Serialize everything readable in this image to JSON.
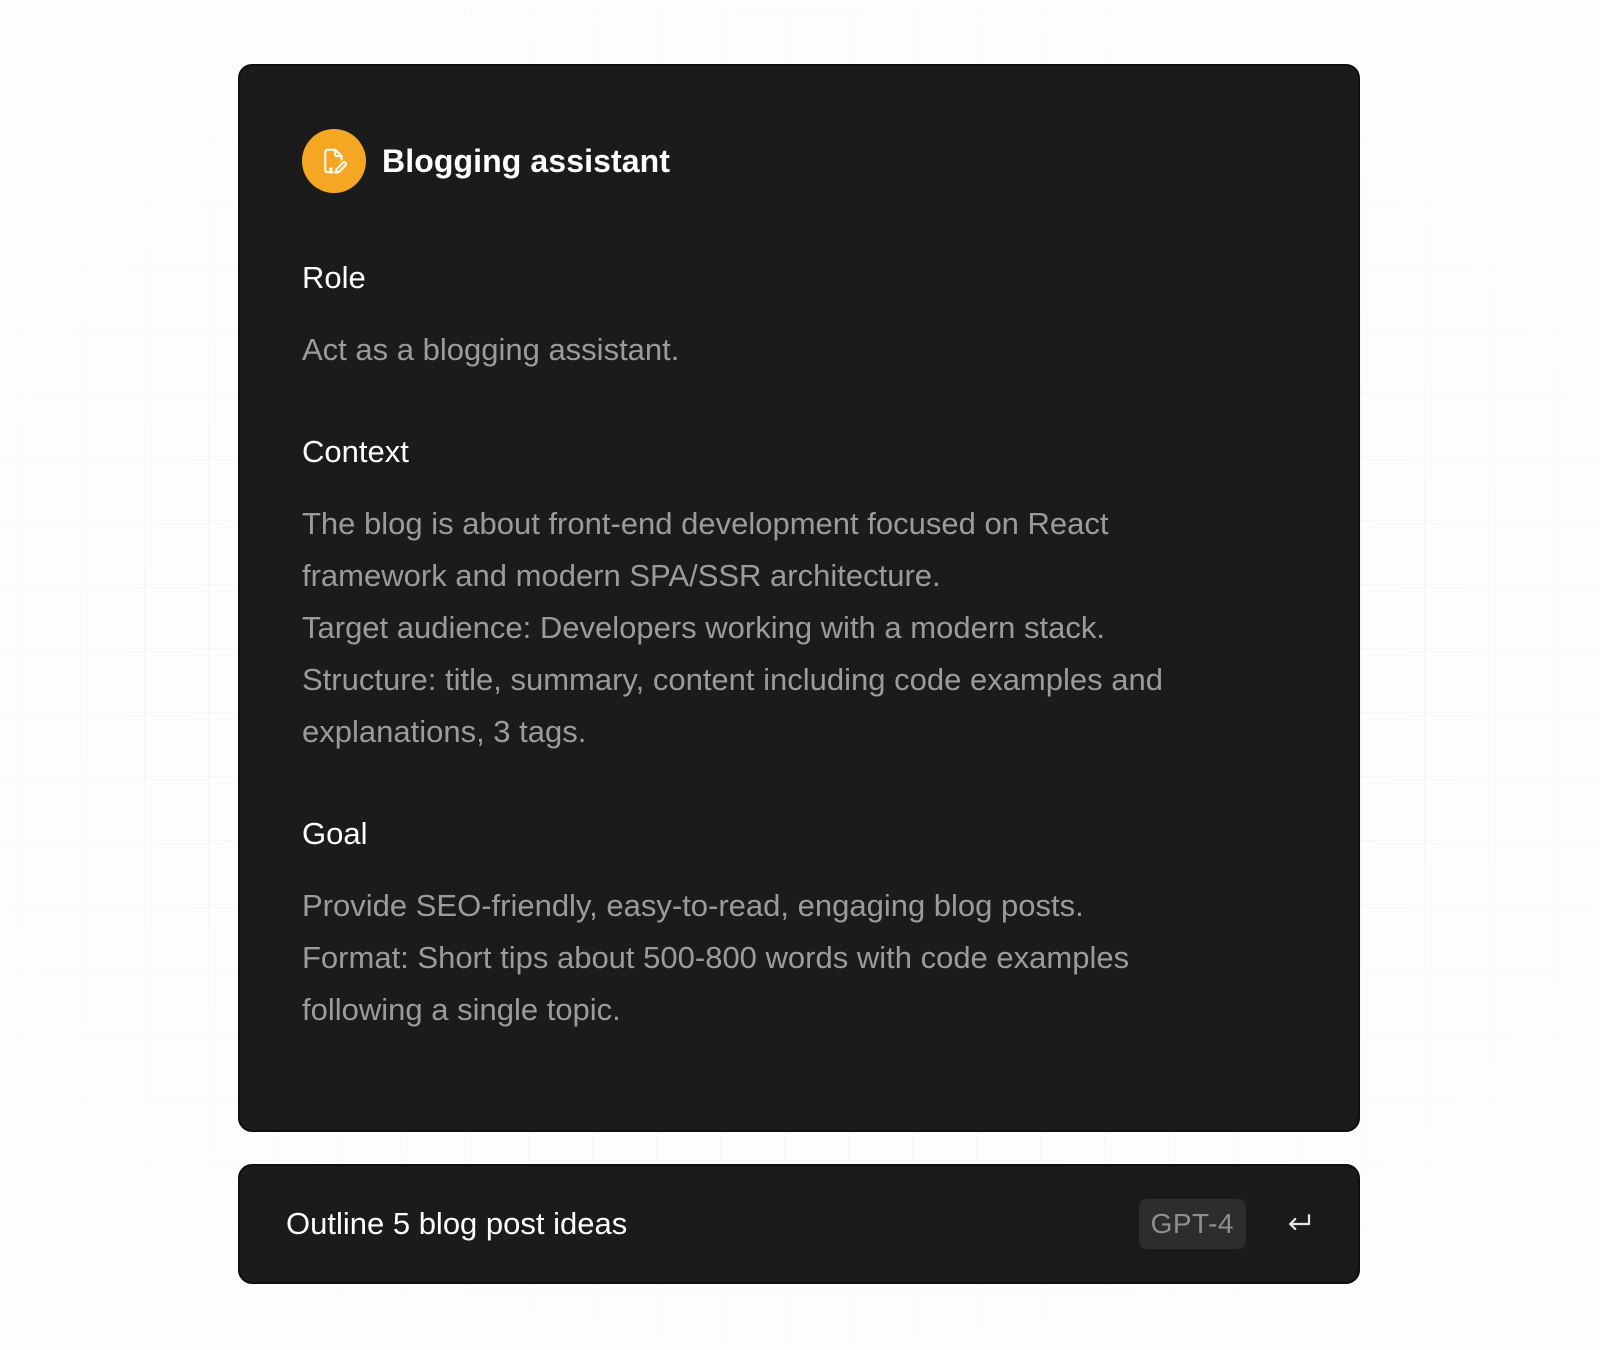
{
  "colors": {
    "accent": "#f5a623",
    "card_background": "#1b1b1b",
    "page_background": "#fdfdfd",
    "muted_text": "#9b9b9b",
    "badge_background": "#2d2d2d"
  },
  "assistant": {
    "icon": "edit-document-icon",
    "name": "Blogging assistant"
  },
  "sections": [
    {
      "title": "Role",
      "lines": [
        "Act as a blogging assistant."
      ]
    },
    {
      "title": "Context",
      "lines": [
        "The blog is about front-end development focused on React",
        "framework and modern SPA/SSR architecture.",
        "Target audience: Developers working with a modern stack.",
        "Structure: title, summary, content including code examples and",
        "explanations, 3 tags."
      ]
    },
    {
      "title": "Goal",
      "lines": [
        "Provide SEO-friendly, easy-to-read, engaging blog posts.",
        "Format: Short tips about 500-800 words with code examples",
        "following a single topic."
      ]
    }
  ],
  "prompt": {
    "text": "Outline 5 blog post ideas",
    "model": "GPT-4",
    "submit_icon": "enter-return-icon"
  }
}
